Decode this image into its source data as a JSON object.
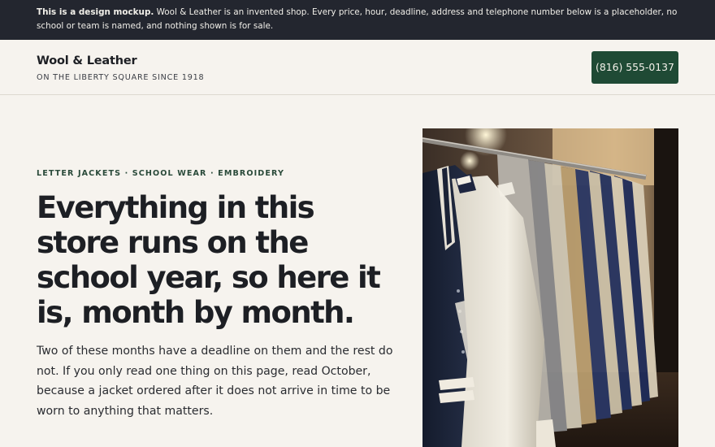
{
  "notice": {
    "bold": "This is a design mockup.",
    "text": " Wool & Leather is an invented shop. Every price, hour, deadline, address and telephone number below is a placeholder, no school or team is named, and nothing shown is for sale."
  },
  "header": {
    "brand_name": "Wool & Leather",
    "brand_tagline": "ON THE LIBERTY SQUARE SINCE 1918",
    "phone_label": "(816) 555-0137"
  },
  "hero": {
    "eyebrow": "LETTER JACKETS · SCHOOL WEAR · EMBROIDERY",
    "headline": "Everything in this store runs on the school year, so here it is, month by month.",
    "lede": "Two of these months have a deadline on them and the rest do not. If you only read one thing on this page, read October, because a jacket ordered after it does not arrive in time to be worn to anything that matters.",
    "photo_icon": "jacket-rack-photo"
  },
  "colors": {
    "notice_bg": "#23262f",
    "page_bg": "#f6f3ee",
    "accent_green": "#1f4a35"
  }
}
